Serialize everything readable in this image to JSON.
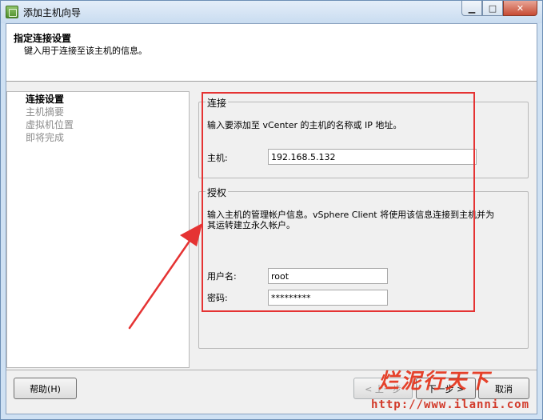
{
  "window": {
    "title": "添加主机向导",
    "controls": [
      "minimize",
      "maximize",
      "close"
    ]
  },
  "header": {
    "title": "指定连接设置",
    "subtitle": "键入用于连接至该主机的信息。"
  },
  "nav": {
    "items": [
      {
        "label": "连接设置",
        "active": true
      },
      {
        "label": "主机摘要",
        "active": false
      },
      {
        "label": "虚拟机位置",
        "active": false
      },
      {
        "label": "即将完成",
        "active": false
      }
    ]
  },
  "connection": {
    "legend": "连接",
    "description": "输入要添加至 vCenter 的主机的名称或 IP 地址。",
    "host_label": "主机:",
    "host_value": "192.168.5.132"
  },
  "auth": {
    "legend": "授权",
    "description_line1": "输入主机的管理帐户信息。vSphere Client 将使用该信息连接到主机并为",
    "description_line2": "其运转建立永久帐户。",
    "username_label": "用户名:",
    "username_value": "root",
    "password_label": "密码:",
    "password_value": "*********"
  },
  "footer": {
    "help_label": "帮助(H)",
    "back_label": "< 上一步",
    "next_label": "下一步 >",
    "cancel_label": "取消"
  },
  "watermark": {
    "text": "烂泥行天下",
    "url": "http://www.ilanni.com"
  },
  "colors": {
    "annotation": "#e53333",
    "window_frame": "#cfe1f3"
  }
}
